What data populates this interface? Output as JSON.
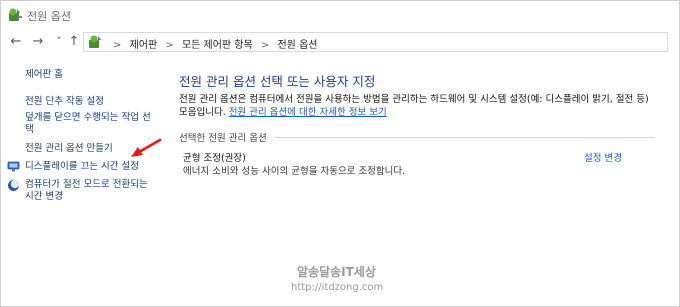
{
  "window": {
    "title": "전원 옵션"
  },
  "nav": {
    "back": "←",
    "forward": "→",
    "dropdown": "˅",
    "up": "↑"
  },
  "breadcrumb": {
    "items": [
      "제어판",
      "모든 제어판 항목",
      "전원 옵션"
    ],
    "separator": ">"
  },
  "sidebar": {
    "home": "제어판 홈",
    "items": [
      {
        "label": "전원 단추 작동 설정",
        "icon": null
      },
      {
        "label": "덮개를 닫으면 수행되는 작업 선택",
        "icon": null
      },
      {
        "label": "전원 관리 옵션 만들기",
        "icon": null
      },
      {
        "label": "디스플레이를 끄는 시간 설정",
        "icon": "monitor-icon"
      },
      {
        "label": "컴퓨터가 절전 모드로 전환되는 시간 변경",
        "icon": "moon-icon"
      }
    ]
  },
  "main": {
    "heading": "전원 관리 옵션 선택 또는 사용자 지정",
    "description": "전원 관리 옵션은 컴퓨터에서 전원을 사용하는 방법을 관리하는 하드웨어 및 시스템 설정(예: 디스플레이 밝기, 절전 등) 모음입니다.",
    "description_link": "전원 관리 옵션에 대한 자세한 정보 보기",
    "section_label": "선택한 전원 관리 옵션",
    "plan": {
      "name": "균형 조정(권장)",
      "description": "에너지 소비와 성능 사이의 균형을 자동으로 조정합니다.",
      "change_link": "설정 변경"
    }
  },
  "watermark": {
    "line1": "알송달송IT세상",
    "line2": "http://itdzong.com"
  },
  "colors": {
    "link": "#1c5cc7",
    "heading": "#1e3c93",
    "sidebar_link": "#1a3e6e",
    "annotation_arrow": "#e21a1a"
  }
}
